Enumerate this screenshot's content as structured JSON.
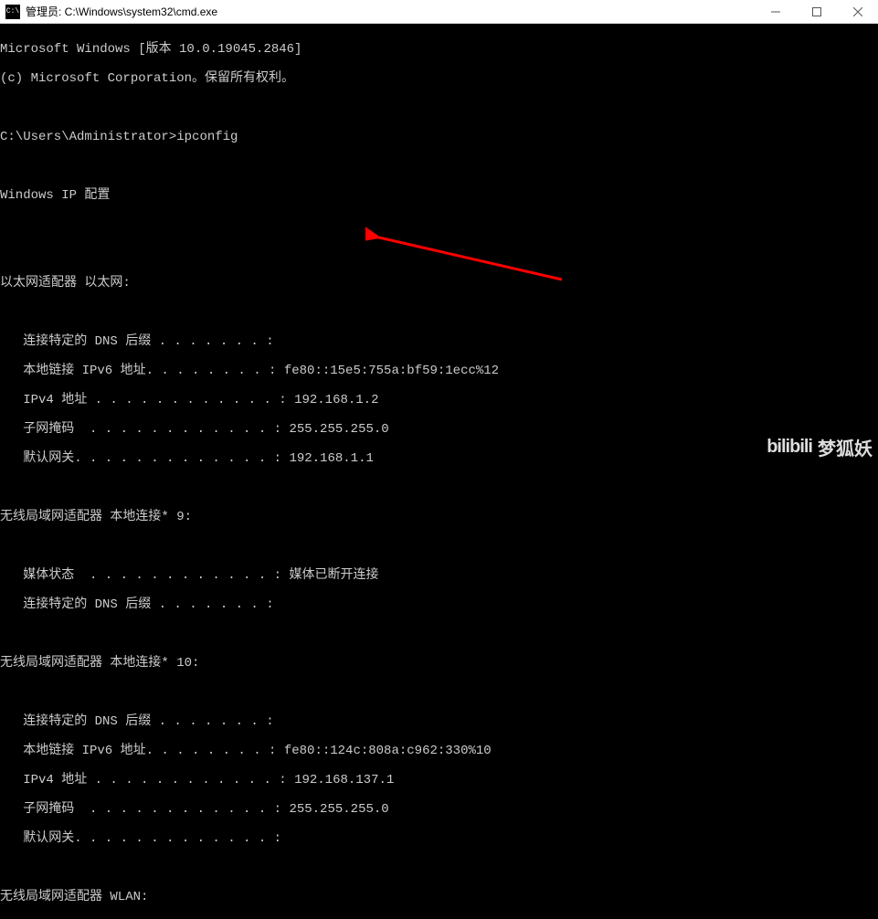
{
  "window": {
    "title": "管理员: C:\\Windows\\system32\\cmd.exe"
  },
  "console": {
    "banner1": "Microsoft Windows [版本 10.0.19045.2846]",
    "banner2": "(c) Microsoft Corporation。保留所有权利。",
    "prompt": "C:\\Users\\Administrator>",
    "command": "ipconfig",
    "heading": "Windows IP 配置",
    "adapters": [
      {
        "title": "以太网适配器 以太网:",
        "lines": {
          "dns_suffix_label": "   连接特定的 DNS 后缀 . . . . . . . :",
          "ipv6_label": "   本地链接 IPv6 地址. . . . . . . . : ",
          "ipv6_value": "fe80::15e5:755a:bf59:1ecc%12",
          "ipv4_label": "   IPv4 地址 . . . . . . . . . . . . : ",
          "ipv4_value": "192.168.1.2",
          "mask_label": "   子网掩码  . . . . . . . . . . . . : ",
          "mask_value": "255.255.255.0",
          "gw_label": "   默认网关. . . . . . . . . . . . . : ",
          "gw_value": "192.168.1.1"
        }
      },
      {
        "title": "无线局域网适配器 本地连接* 9:",
        "lines": {
          "media_label": "   媒体状态  . . . . . . . . . . . . : ",
          "media_value": "媒体已断开连接",
          "dns_suffix_label": "   连接特定的 DNS 后缀 . . . . . . . :"
        }
      },
      {
        "title": "无线局域网适配器 本地连接* 10:",
        "lines": {
          "dns_suffix_label": "   连接特定的 DNS 后缀 . . . . . . . :",
          "ipv6_label": "   本地链接 IPv6 地址. . . . . . . . : ",
          "ipv6_value": "fe80::124c:808a:c962:330%10",
          "ipv4_label": "   IPv4 地址 . . . . . . . . . . . . : ",
          "ipv4_value": "192.168.137.1",
          "mask_label": "   子网掩码  . . . . . . . . . . . . : ",
          "mask_value": "255.255.255.0",
          "gw_label": "   默认网关. . . . . . . . . . . . . :"
        }
      },
      {
        "title": "无线局域网适配器 WLAN:"
      }
    ]
  },
  "annotation": {
    "color": "#ff0000",
    "highlighted_value": "默认网关 192.168.1.1"
  },
  "watermark": {
    "logo": "bilibili",
    "name": "梦狐妖"
  }
}
